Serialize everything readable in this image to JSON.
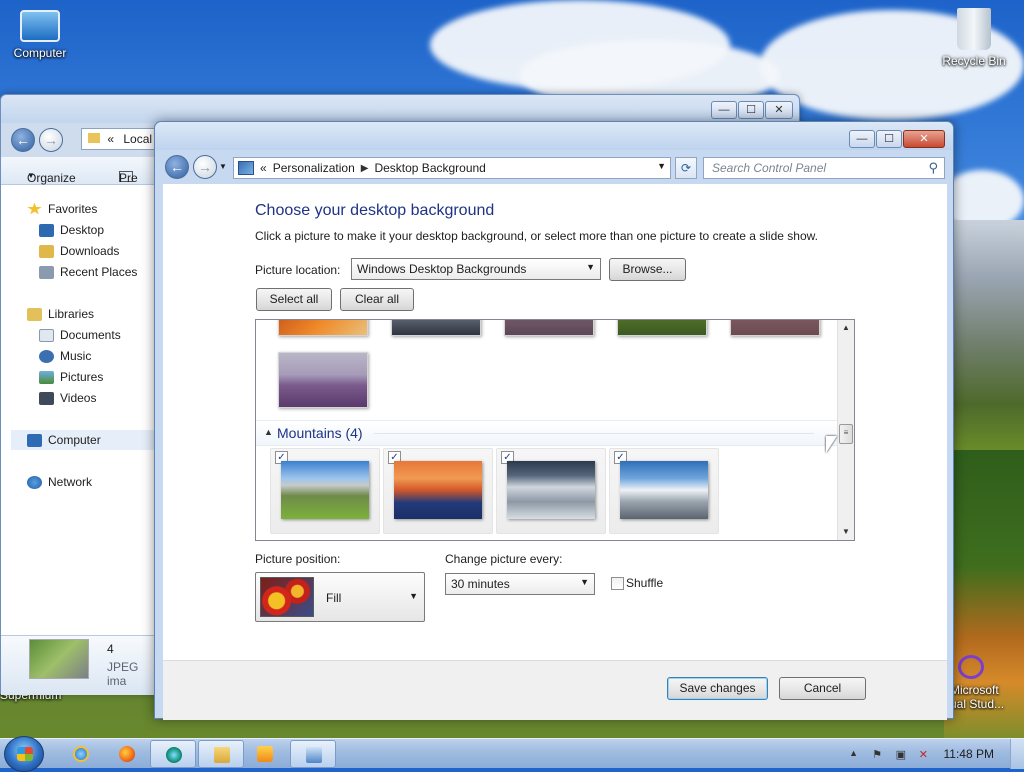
{
  "desktop": {
    "icons": [
      {
        "label": "Computer"
      },
      {
        "label": "Recycle Bin"
      },
      {
        "label": "Supermium"
      },
      {
        "label": "Microsoft Visual Stud..."
      }
    ],
    "icons_visible_text": {
      "supermium": "Supermium",
      "vs_line1": "Microsoft",
      "vs_line2": "ual Stud..."
    }
  },
  "explorer": {
    "address_text": "Local D",
    "toolbar": {
      "organize": "Organize",
      "preview": "Pre"
    },
    "nav": {
      "favorites": "Favorites",
      "desktop": "Desktop",
      "downloads": "Downloads",
      "recent": "Recent Places",
      "libraries": "Libraries",
      "documents": "Documents",
      "music": "Music",
      "pictures": "Pictures",
      "videos": "Videos",
      "computer": "Computer",
      "network": "Network"
    },
    "details": {
      "count": "4",
      "type": "JPEG ima"
    }
  },
  "control_panel": {
    "breadcrumb": {
      "prefix": "«",
      "item1": "Personalization",
      "item2": "Desktop Background"
    },
    "search_placeholder": "Search Control Panel",
    "heading": "Choose your desktop background",
    "subtext": "Click a picture to make it your desktop background, or select more than one picture to create a slide show.",
    "picture_location_label": "Picture location:",
    "picture_location_value": "Windows Desktop Backgrounds",
    "browse_label": "Browse...",
    "select_all_label": "Select all",
    "clear_all_label": "Clear all",
    "group_title": "Mountains (4)",
    "picture_position_label": "Picture position:",
    "picture_position_value": "Fill",
    "change_every_label": "Change picture every:",
    "change_every_value": "30 minutes",
    "shuffle_label": "Shuffle",
    "save_label": "Save changes",
    "cancel_label": "Cancel",
    "mountain_tiles": [
      {
        "name": "green-valley-mountain",
        "checked": true
      },
      {
        "name": "sunset-mountain",
        "checked": true
      },
      {
        "name": "rocky-snow-mountain",
        "checked": true
      },
      {
        "name": "snow-peak-mountain",
        "checked": true
      }
    ],
    "check_mark": "✓"
  },
  "taskbar": {
    "clock": "11:48 PM"
  },
  "glyphs": {
    "back": "←",
    "forward": "→",
    "dropdown": "▼",
    "up": "▲",
    "collapse": "◢",
    "search": "⚲",
    "refresh": "⟳",
    "minimize": "—",
    "maximize": "☐",
    "close": "✕",
    "scroll_grip": "≡",
    "chevrons": "«"
  },
  "colors": {
    "heading": "#1e3287",
    "accent": "#2f5fa1"
  }
}
